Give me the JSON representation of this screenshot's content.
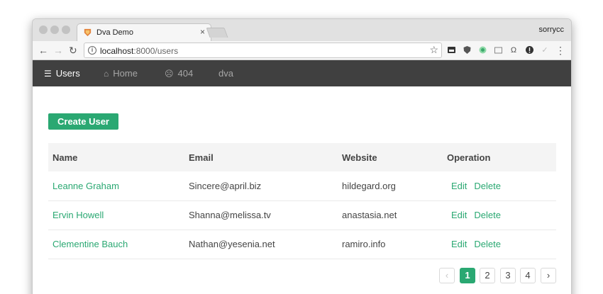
{
  "browser": {
    "tab_title": "Dva Demo",
    "tab_close": "×",
    "profile_name": "sorrycc",
    "url_host": "localhost",
    "url_path": ":8000/users",
    "back": "←",
    "forward": "→",
    "reload": "↻",
    "bookmark": "☆",
    "menu": "⋮"
  },
  "app_nav": {
    "items": [
      {
        "label": "Users",
        "icon": "list-icon",
        "glyph": "☰",
        "active": true
      },
      {
        "label": "Home",
        "icon": "home-icon",
        "glyph": "⌂",
        "active": false
      },
      {
        "label": "404",
        "icon": "frown-icon",
        "glyph": "☹",
        "active": false
      },
      {
        "label": "dva",
        "active": false
      }
    ]
  },
  "create_button": "Create User",
  "table": {
    "headers": [
      "Name",
      "Email",
      "Website",
      "Operation"
    ],
    "rows": [
      {
        "name": "Leanne Graham",
        "email": "Sincere@april.biz",
        "website": "hildegard.org"
      },
      {
        "name": "Ervin Howell",
        "email": "Shanna@melissa.tv",
        "website": "anastasia.net"
      },
      {
        "name": "Clementine Bauch",
        "email": "Nathan@yesenia.net",
        "website": "ramiro.info"
      }
    ],
    "actions": {
      "edit": "Edit",
      "delete": "Delete"
    }
  },
  "pagination": {
    "prev": "‹",
    "next": "›",
    "pages": [
      "1",
      "2",
      "3",
      "4"
    ],
    "current": "1"
  },
  "colors": {
    "accent": "#2aa872",
    "nav_bg": "#404040"
  }
}
